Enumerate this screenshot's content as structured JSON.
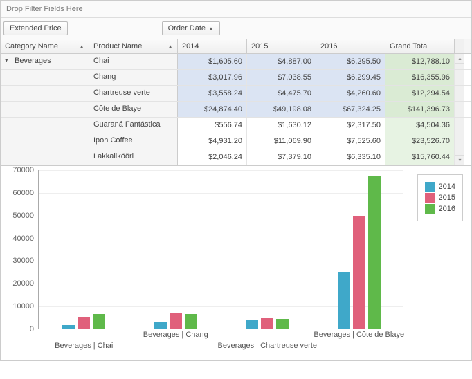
{
  "filter_drop_label": "Drop Filter Fields Here",
  "data_field": {
    "label": "Extended Price"
  },
  "column_field": {
    "label": "Order Date"
  },
  "row_fields": [
    {
      "label": "Category Name"
    },
    {
      "label": "Product Name"
    }
  ],
  "year_headers": [
    "2014",
    "2015",
    "2016"
  ],
  "grand_total_header": "Grand Total",
  "category_label": "Beverages",
  "rows": [
    {
      "product": "Chai",
      "hl": true,
      "y": [
        "$1,605.60",
        "$4,887.00",
        "$6,295.50"
      ],
      "gt": "$12,788.10"
    },
    {
      "product": "Chang",
      "hl": true,
      "y": [
        "$3,017.96",
        "$7,038.55",
        "$6,299.45"
      ],
      "gt": "$16,355.96"
    },
    {
      "product": "Chartreuse verte",
      "hl": true,
      "y": [
        "$3,558.24",
        "$4,475.70",
        "$4,260.60"
      ],
      "gt": "$12,294.54"
    },
    {
      "product": "Côte de Blaye",
      "hl": true,
      "y": [
        "$24,874.40",
        "$49,198.08",
        "$67,324.25"
      ],
      "gt": "$141,396.73"
    },
    {
      "product": "Guaraná Fantástica",
      "hl": false,
      "y": [
        "$556.74",
        "$1,630.12",
        "$2,317.50"
      ],
      "gt": "$4,504.36"
    },
    {
      "product": "Ipoh Coffee",
      "hl": false,
      "y": [
        "$4,931.20",
        "$11,069.90",
        "$7,525.60"
      ],
      "gt": "$23,526.70"
    },
    {
      "product": "Lakkalikööri",
      "hl": false,
      "y": [
        "$2,046.24",
        "$7,379.10",
        "$6,335.10"
      ],
      "gt": "$15,760.44"
    }
  ],
  "chart_data": {
    "type": "bar",
    "categories": [
      "Beverages | Chai",
      "Beverages | Chang",
      "Beverages | Chartreuse verte",
      "Beverages | Côte de Blaye"
    ],
    "series": [
      {
        "name": "2014",
        "values": [
          1605.6,
          3017.96,
          3558.24,
          24874.4
        ]
      },
      {
        "name": "2015",
        "values": [
          4887.0,
          7038.55,
          4475.7,
          49198.08
        ]
      },
      {
        "name": "2016",
        "values": [
          6295.5,
          6299.45,
          4260.6,
          67324.25
        ]
      }
    ],
    "ylim": [
      0,
      70000
    ],
    "yticks": [
      0,
      10000,
      20000,
      30000,
      40000,
      50000,
      60000,
      70000
    ],
    "colors": {
      "2014": "#3fa8c9",
      "2015": "#e0607b",
      "2016": "#5fb94a"
    }
  }
}
